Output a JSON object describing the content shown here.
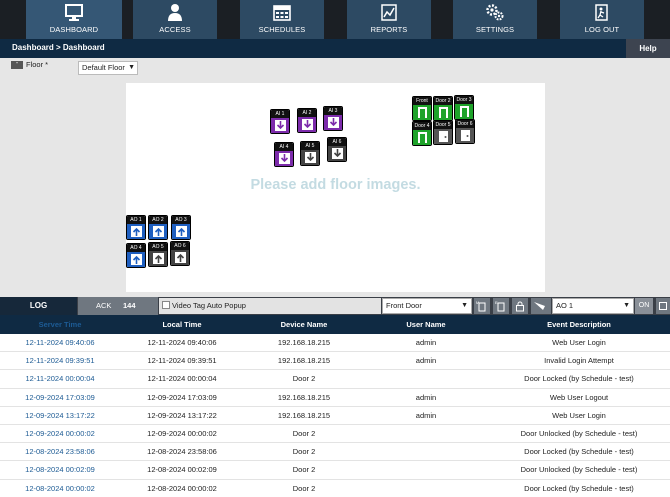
{
  "nav": {
    "items": [
      {
        "label": "DASHBOARD",
        "icon": "monitor-icon"
      },
      {
        "label": "ACCESS",
        "icon": "person-icon"
      },
      {
        "label": "SCHEDULES",
        "icon": "calendar-icon"
      },
      {
        "label": "REPORTS",
        "icon": "report-chart-icon"
      },
      {
        "label": "SETTINGS",
        "icon": "gears-icon"
      },
      {
        "label": "LOG OUT",
        "icon": "exit-door-icon"
      }
    ]
  },
  "breadcrumb": "Dashboard > Dashboard",
  "help_label": "Help",
  "floor": {
    "collapse_symbol": "-",
    "label": "Floor *",
    "selected": "Default Floor",
    "empty_message": "Please add floor images."
  },
  "devices": {
    "ai": [
      "AI 1",
      "AI 2",
      "AI 3",
      "AI 4",
      "AI 5",
      "AI 6"
    ],
    "doors": [
      "Front",
      "Door 2",
      "Door 3",
      "Door 4",
      "Door 5",
      "Door 6"
    ],
    "ao": [
      "AO 1",
      "AO 2",
      "AO 3",
      "AO 4",
      "AO 5",
      "AO 6"
    ]
  },
  "log_toolbar": {
    "log_label": "LOG",
    "ack_label": "ACK",
    "ack_count": "144",
    "video_tag_label": "Video Tag Auto Popup",
    "door_selected": "Front Door",
    "output_selected": "AO 1",
    "on_label": "ON"
  },
  "events": {
    "columns": [
      "Server Time",
      "Local Time",
      "Device Name",
      "User Name",
      "Event Description"
    ],
    "rows": [
      [
        "12-11-2024 09:40:06",
        "12-11-2024 09:40:06",
        "192.168.18.215",
        "admin",
        "Web User Login"
      ],
      [
        "12-11-2024 09:39:51",
        "12-11-2024 09:39:51",
        "192.168.18.215",
        "admin",
        "Invalid Login Attempt"
      ],
      [
        "12-11-2024 00:00:04",
        "12-11-2024 00:00:04",
        "Door 2",
        "",
        "Door Locked (by Schedule - test)"
      ],
      [
        "12-09-2024 17:03:09",
        "12-09-2024 17:03:09",
        "192.168.18.215",
        "admin",
        "Web User Logout"
      ],
      [
        "12-09-2024 13:17:22",
        "12-09-2024 13:17:22",
        "192.168.18.215",
        "admin",
        "Web User Login"
      ],
      [
        "12-09-2024 00:00:02",
        "12-09-2024 00:00:02",
        "Door 2",
        "",
        "Door Unlocked (by Schedule - test)"
      ],
      [
        "12-08-2024 23:58:06",
        "12-08-2024 23:58:06",
        "Door 2",
        "",
        "Door Locked (by Schedule - test)"
      ],
      [
        "12-08-2024 00:02:09",
        "12-08-2024 00:02:09",
        "Door 2",
        "",
        "Door Unlocked (by Schedule - test)"
      ],
      [
        "12-08-2024 00:00:02",
        "12-08-2024 00:00:02",
        "Door 2",
        "",
        "Door Locked (by Schedule - test)"
      ]
    ]
  }
}
